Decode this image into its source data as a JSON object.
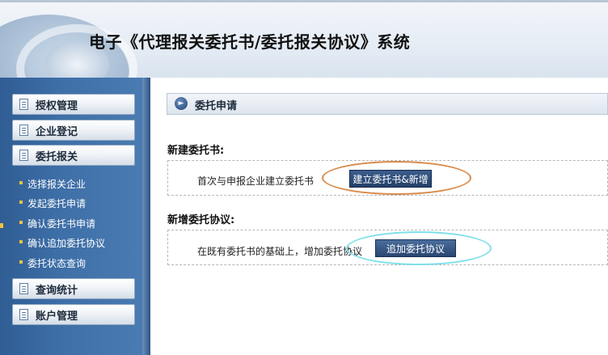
{
  "app": {
    "title": "电子《代理报关委托书/委托报关协议》系统"
  },
  "sidebar": {
    "items": [
      {
        "label": "授权管理",
        "icon": "document-icon"
      },
      {
        "label": "企业登记",
        "icon": "document-icon"
      },
      {
        "label": "委托报关",
        "icon": "document-icon"
      },
      {
        "label": "查询统计",
        "icon": "document-icon"
      },
      {
        "label": "账户管理",
        "icon": "document-icon"
      }
    ],
    "subitems": [
      {
        "label": "选择报关企业"
      },
      {
        "label": "发起委托申请"
      },
      {
        "label": "确认委托书申请"
      },
      {
        "label": "确认追加委托协议"
      },
      {
        "label": "委托状态查询"
      }
    ]
  },
  "main": {
    "section_title": "委托申请",
    "new_letter": {
      "title": "新建委托书:",
      "text": "首次与申报企业建立委托书",
      "button_label": "建立委托书&新增"
    },
    "new_agreement": {
      "title": "新增委托协议:",
      "text": "在既有委托书的基础上，增加委托协议",
      "button_label": "追加委托协议"
    }
  },
  "colors": {
    "sidebar": "#3e6fa7",
    "button": "#2a4671",
    "annotation_orange": "#d98a4a",
    "annotation_cyan": "#7fe0ea",
    "bullet": "#f0c23a"
  }
}
